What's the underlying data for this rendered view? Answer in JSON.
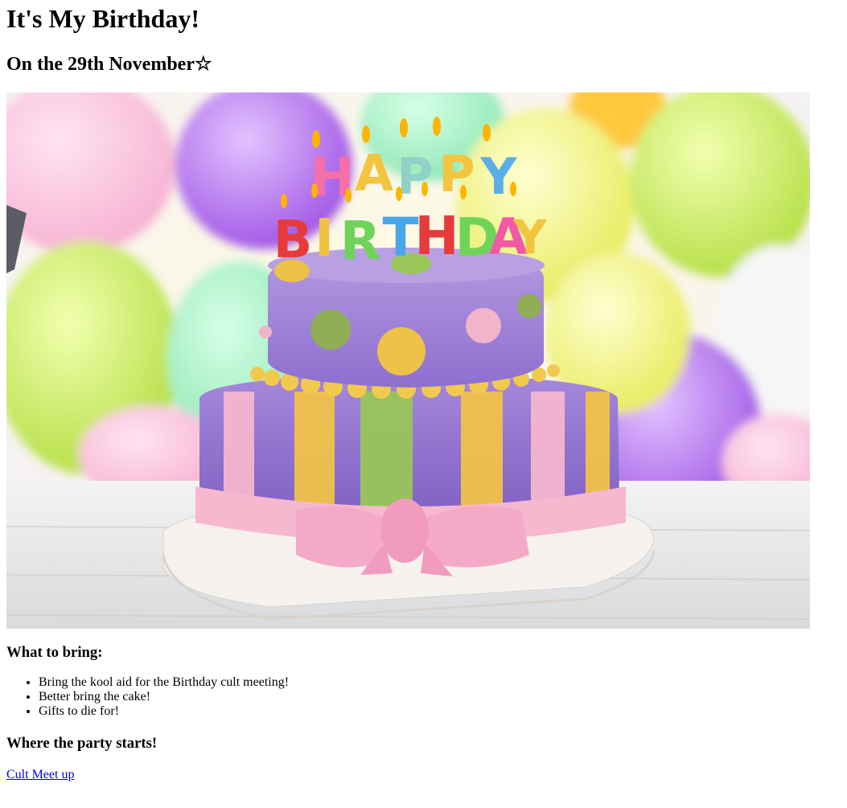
{
  "title": "It's My Birthday!",
  "subtitle": "On the 29th November☆",
  "image": {
    "description_icon": "birthday-cake-photo",
    "cake_text_top": "HAPPY",
    "cake_text_bottom": "BIRTHDAY"
  },
  "bring": {
    "heading": "What to bring:",
    "items": [
      "Bring the kool aid for the Birthday cult meeting!",
      "Better bring the cake!",
      "Gifts to die for!"
    ]
  },
  "party": {
    "heading": "Where the party starts!",
    "link_text": "Cult Meet up"
  },
  "colors": {
    "link": "#0000ee"
  }
}
